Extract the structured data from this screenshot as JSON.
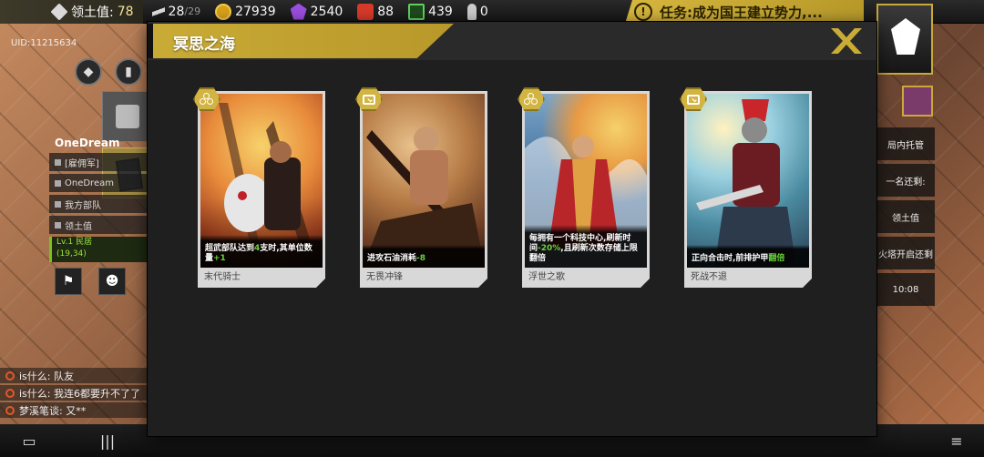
{
  "topbar": {
    "territory_label": "领土值:",
    "territory_value": "78",
    "energy_value": "28",
    "energy_max": "/29",
    "gold_value": "27939",
    "gem_value": "2540",
    "oil_value": "88",
    "chip_value": "439",
    "ammo_value": "0",
    "task_label": "任务:成为国王建立势力,..."
  },
  "uid": "UID:11215634",
  "player": {
    "name": "OneDream",
    "rows": [
      "[雇佣军]",
      "OneDream",
      "我方部队",
      "领土值"
    ],
    "level": "Lv.1 民居",
    "coords": "(19,34)"
  },
  "right_panel": {
    "items": [
      "局内托管",
      "一名还剩:",
      "领土值",
      "火塔开启还剩",
      "10:08"
    ]
  },
  "chat": [
    {
      "text": "is什么: 队友"
    },
    {
      "text": "is什么: 我连6都要升不了了"
    },
    {
      "text": "梦溪笔谈: 又**"
    }
  ],
  "modal": {
    "title": "冥思之海",
    "cards": [
      {
        "name": "末代骑士",
        "desc_pre": "超武部队达到",
        "desc_hl1": "4",
        "desc_mid": "支时,其单位数量",
        "desc_hl2": "+1",
        "desc_post": "",
        "badge": "triad-icon"
      },
      {
        "name": "无畏冲锋",
        "desc_pre": "进攻石油消耗",
        "desc_hl1": "-8",
        "desc_mid": "",
        "desc_hl2": "",
        "desc_post": "",
        "badge": "box-icon"
      },
      {
        "name": "浮世之歌",
        "desc_pre": "每拥有一个科技中心,刷新时间",
        "desc_hl1": "-20%",
        "desc_mid": ",且刷新次数存储上限翻倍",
        "desc_hl2": "",
        "desc_post": "",
        "badge": "triad-icon"
      },
      {
        "name": "死战不退",
        "desc_pre": "正向合击时,前排护甲",
        "desc_hl1": "翻倍",
        "desc_mid": "",
        "desc_hl2": "",
        "desc_post": "",
        "badge": "box-icon"
      }
    ]
  },
  "colors": {
    "accent_gold": "#c9ab36",
    "highlight_green": "#6ad13a",
    "modal_bg": "#1f1f1f"
  }
}
